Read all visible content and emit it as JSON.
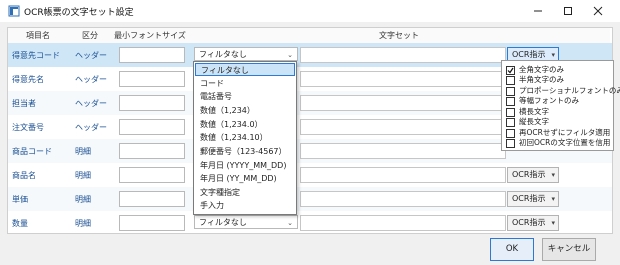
{
  "window": {
    "title": "OCR帳票の文字セット設定",
    "controls": [
      "minimize",
      "maximize",
      "close"
    ]
  },
  "table": {
    "headers": [
      "項目名",
      "区分",
      "最小フォントサイズ",
      "文字セット"
    ],
    "rows": [
      {
        "name": "得意先コード",
        "kubun": "ヘッダー",
        "filter": "フィルタなし",
        "ocr": "OCR指示"
      },
      {
        "name": "得意先名",
        "kubun": "ヘッダー",
        "filter": "",
        "ocr": ""
      },
      {
        "name": "担当者",
        "kubun": "ヘッダー",
        "filter": "",
        "ocr": ""
      },
      {
        "name": "注文番号",
        "kubun": "ヘッダー",
        "filter": "",
        "ocr": ""
      },
      {
        "name": "商品コード",
        "kubun": "明細",
        "filter": "",
        "ocr": ""
      },
      {
        "name": "商品名",
        "kubun": "明細",
        "filter": "",
        "ocr": "OCR指示"
      },
      {
        "name": "単価",
        "kubun": "明細",
        "filter": "",
        "ocr": "OCR指示"
      },
      {
        "name": "数量",
        "kubun": "明細",
        "filter": "フィルタなし",
        "ocr": "OCR指示"
      }
    ]
  },
  "filter_dropdown": {
    "options": [
      "フィルタなし",
      "コード",
      "電話番号",
      "数値（1,234）",
      "数値（1,234.0）",
      "数値（1,234.10）",
      "郵便番号（123-4567）",
      "年月日 (YYYY_MM_DD)",
      "年月日 (YY_MM_DD)",
      "文字種指定",
      "手入力"
    ],
    "selected_index": 0
  },
  "ocr_menu": {
    "items": [
      {
        "label": "全角文字のみ",
        "checked": true
      },
      {
        "label": "半角文字のみ",
        "checked": false
      },
      {
        "label": "プロポーショナルフォントのみ",
        "checked": false
      },
      {
        "label": "等幅フォントのみ",
        "checked": false
      },
      {
        "label": "横長文字",
        "checked": false
      },
      {
        "label": "縦長文字",
        "checked": false
      },
      {
        "label": "再OCRせずにフィルタ適用",
        "checked": false
      },
      {
        "label": "初回OCRの文字位置を信用",
        "checked": false
      }
    ]
  },
  "buttons": {
    "ok": "OK",
    "cancel": "キャンセル"
  }
}
